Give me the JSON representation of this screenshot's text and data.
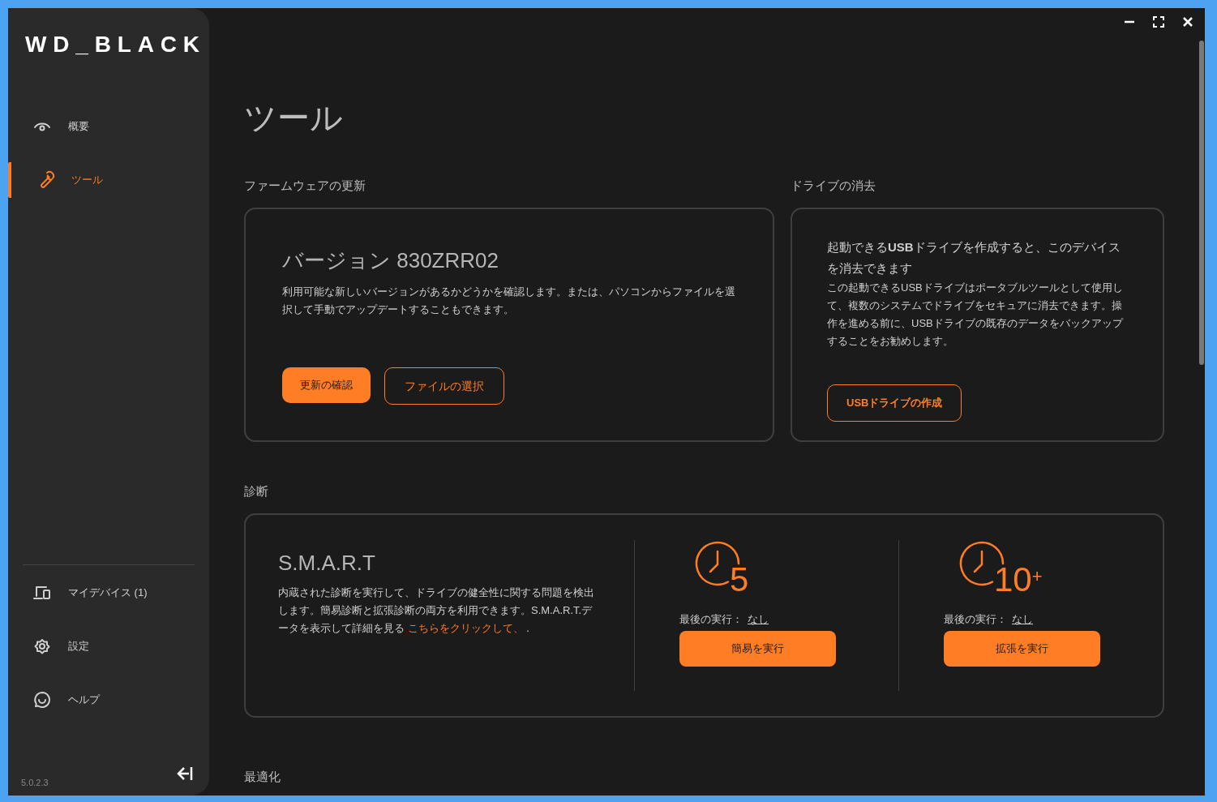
{
  "sidebar": {
    "logo": "WD_BLACK",
    "nav_items": [
      {
        "kind": "eye",
        "label": "概要",
        "selected": false
      },
      {
        "kind": "wrench",
        "label": "ツール",
        "selected": true
      }
    ],
    "bottom_items": [
      {
        "kind": "devices",
        "label": "マイデバイス (1)"
      },
      {
        "kind": "gear",
        "label": "設定"
      },
      {
        "kind": "help",
        "label": "ヘルプ"
      }
    ],
    "version": "5.0.2.3"
  },
  "page_title": "ツール",
  "firmware": {
    "section_label": "ファームウェアの更新",
    "title": "バージョン 830ZRR02",
    "description": "利用可能な新しいバージョンがあるかどうかを確認します。または、パソコンからファイルを選択して手動でアップデートすることもできます。",
    "buttons": [
      {
        "kind": "primary",
        "label": "更新の確認"
      },
      {
        "kind": "outline",
        "label": "ファイルの選択"
      }
    ]
  },
  "erase": {
    "section_label": "ドライブの消去",
    "lead": "起動できる**USB**ドライブを作成すると、このデバイスを消去できます",
    "description": "この起動できるUSBドライブはポータブルツールとして使用して、複数のシステムでドライブをセキュアに消去できます。操作を進める前に、USBドライブの既存のデータをバックアップすることをお勧めします。",
    "button": "USBドライブの作成"
  },
  "diagnostics": {
    "section_label": "診断",
    "title": "S.M.A.R.T",
    "description": "内蔵された診断を実行して、ドライブの健全性に関する問題を検出します。簡易診断と拡張診断の両方を利用できます。S.M.A.R.T.データを表示して詳細を見る",
    "link": "こちらをクリックして、",
    "trailing": ".",
    "tests": [
      {
        "minutes": "5",
        "last_run_label": "最後の実行：",
        "last_run_value": "なし",
        "button": "簡易を実行"
      },
      {
        "minutes": "10$^{+}$",
        "last_run_label": "最後の実行：",
        "last_run_value": "なし",
        "button": "拡張を実行"
      }
    ]
  },
  "next_section_label": "最適化"
}
